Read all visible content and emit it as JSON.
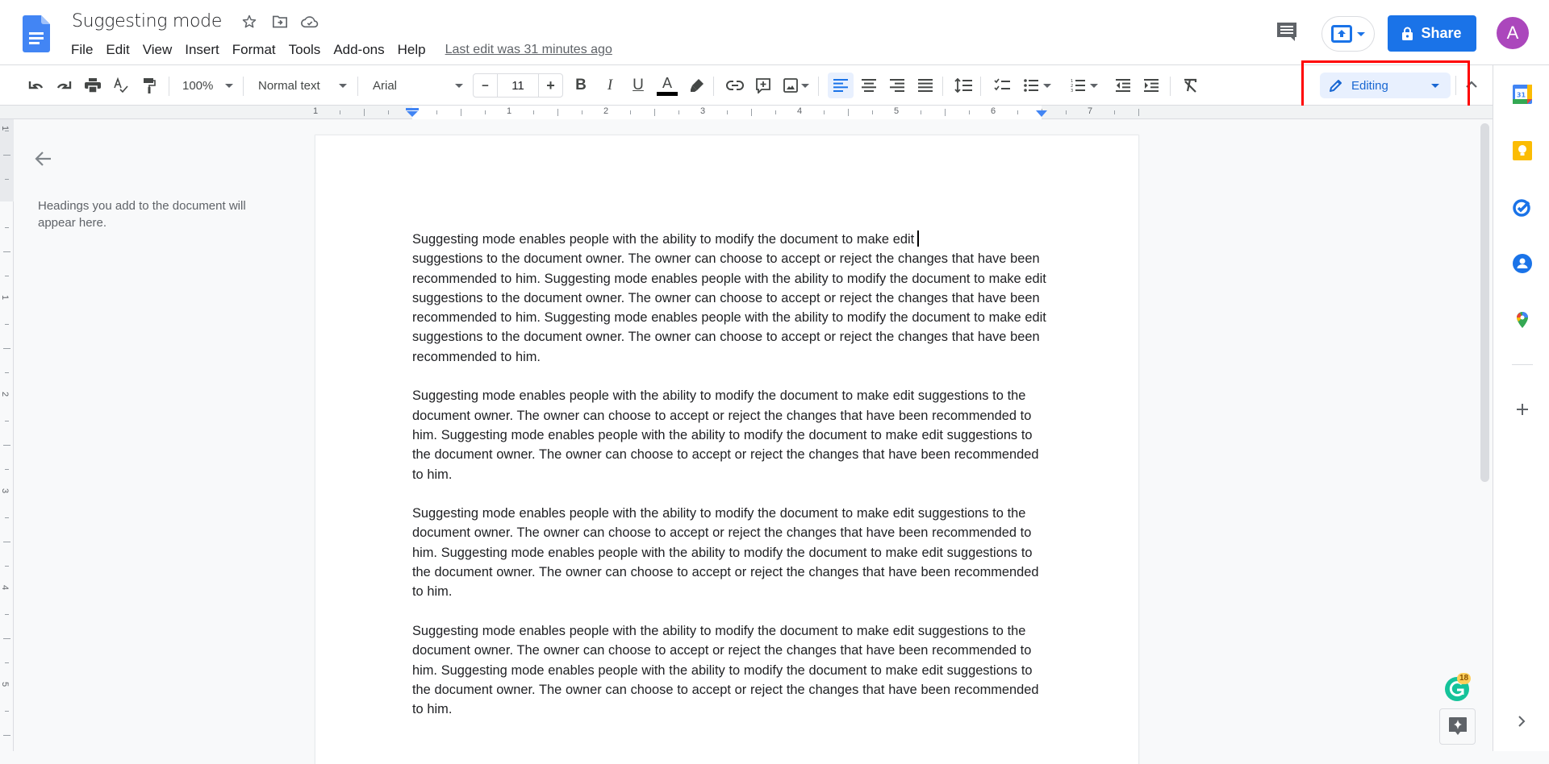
{
  "header": {
    "doc_title": "Suggesting mode",
    "menu": [
      "File",
      "Edit",
      "View",
      "Insert",
      "Format",
      "Tools",
      "Add-ons",
      "Help"
    ],
    "last_edit": "Last edit was 31 minutes ago",
    "share_label": "Share",
    "avatar_letter": "A"
  },
  "toolbar": {
    "zoom": "100%",
    "style": "Normal text",
    "font": "Arial",
    "font_size": "11",
    "decrease_label": "−",
    "increase_label": "+",
    "bold_label": "B",
    "italic_label": "I",
    "underline_label": "U",
    "text_color_label": "A",
    "mode": "Editing"
  },
  "ruler": {
    "h_labels": [
      "1",
      "1",
      "2",
      "3",
      "4",
      "5",
      "6",
      "7"
    ],
    "v_labels": [
      "1",
      "1",
      "2",
      "3",
      "4",
      "5"
    ]
  },
  "outline": {
    "hint": "Headings you add to the document will appear here."
  },
  "document": {
    "paragraphs": [
      "Suggesting mode enables people with the ability to modify the document to make edit suggestions to the document owner. The owner can choose to accept or reject the changes that have been recommended to him. Suggesting mode enables people with the ability to modify the document to make edit suggestions to the document owner. The owner can choose to accept or reject the changes that have been recommended to him. Suggesting mode enables people with the ability to modify the document to make edit suggestions to the document owner. The owner can choose to accept or reject the changes that have been recommended to him.",
      "Suggesting mode enables people with the ability to modify the document to make edit suggestions to the document owner. The owner can choose to accept or reject the changes that have been recommended to him. Suggesting mode enables people with the ability to modify the document to make edit suggestions to the document owner. The owner can choose to accept or reject the changes that have been recommended to him.",
      "Suggesting mode enables people with the ability to modify the document to make edit suggestions to the document owner. The owner can choose to accept or reject the changes that have been recommended to him. Suggesting mode enables people with the ability to modify the document to make edit suggestions to the document owner. The owner can choose to accept or reject the changes that have been recommended to him.",
      "Suggesting mode enables people with the ability to modify the document to make edit suggestions to the document owner. The owner can choose to accept or reject the changes that have been recommended to him. Suggesting mode enables people with the ability to modify the document to make edit suggestions to the document owner. The owner can choose to accept or reject the changes that have been recommended to him."
    ],
    "first_line": "Suggesting mode enables people with the ability to modify the document to make edit",
    "first_rest": "suggestions to the document owner. The owner can choose to accept or reject the changes that have been recommended to him. Suggesting mode enables people with the ability to modify the document to make edit suggestions to the document owner. The owner can choose to accept or reject the changes that have been recommended to him. Suggesting mode enables people with the ability to modify the document to make edit suggestions to the document owner. The owner can choose to accept or reject the changes that have been recommended to him."
  },
  "grammarly": {
    "count": "18"
  },
  "side_panel": {
    "calendar_day": "31",
    "apps": [
      "calendar-icon",
      "keep-icon",
      "tasks-icon",
      "contacts-icon",
      "maps-icon"
    ]
  },
  "colors": {
    "accent": "#1a73e8",
    "highlight_box": "#ff0000",
    "avatar": "#ab47bc",
    "editing_bg": "#e8f0fe"
  }
}
